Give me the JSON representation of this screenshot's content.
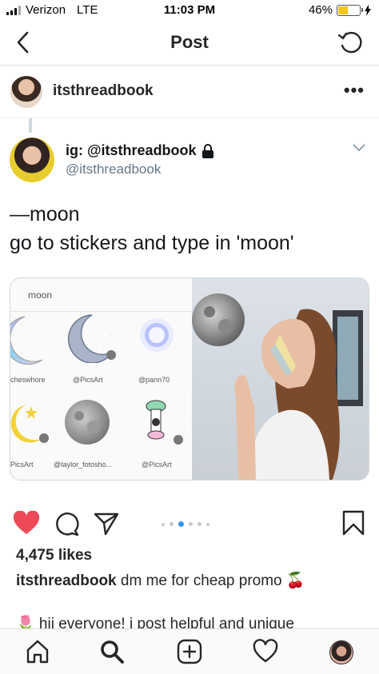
{
  "status_bar": {
    "carrier": "Verizon",
    "network": "LTE",
    "time": "11:03 PM",
    "battery": "46%",
    "battery_level": 0.46
  },
  "nav": {
    "title": "Post",
    "back_icon": "chevron-left-icon",
    "refresh_icon": "refresh-icon"
  },
  "post": {
    "username": "itsthreadbook",
    "more_icon": "more-icon"
  },
  "tweet": {
    "display_name": "ig: @itsthreadbook",
    "handle": "@itsthreadbook",
    "text_line1": "—moon",
    "text_line2": "go to stickers and type in 'moon'",
    "media": {
      "search_text": "moon",
      "stickers": [
        {
          "caption": "cheswhore"
        },
        {
          "caption": "@PicsArt"
        },
        {
          "caption": "@pann70"
        },
        {
          "caption": "PicsArt"
        },
        {
          "caption": "@taylor_fotosho..."
        },
        {
          "caption": "@PicsArt"
        }
      ]
    }
  },
  "actions": {
    "like_icon": "heart-filled-icon",
    "comment_icon": "comment-icon",
    "share_icon": "share-icon",
    "save_icon": "bookmark-icon",
    "carousel_pages": 6,
    "carousel_active": 3
  },
  "likes": "4,475 likes",
  "caption": {
    "username": "itsthreadbook",
    "text": " dm me for cheap promo 🍒",
    "second_line": "🌷 hii everyone! i post helpful and unique"
  },
  "tabbar": {
    "items": [
      "home-icon",
      "search-icon",
      "new-post-icon",
      "activity-icon",
      "profile-avatar"
    ]
  },
  "colors": {
    "like_red": "#ed4956",
    "link_blue": "#3897f0",
    "battery_yellow": "#f5c61a",
    "twitter_gray": "#657786"
  }
}
